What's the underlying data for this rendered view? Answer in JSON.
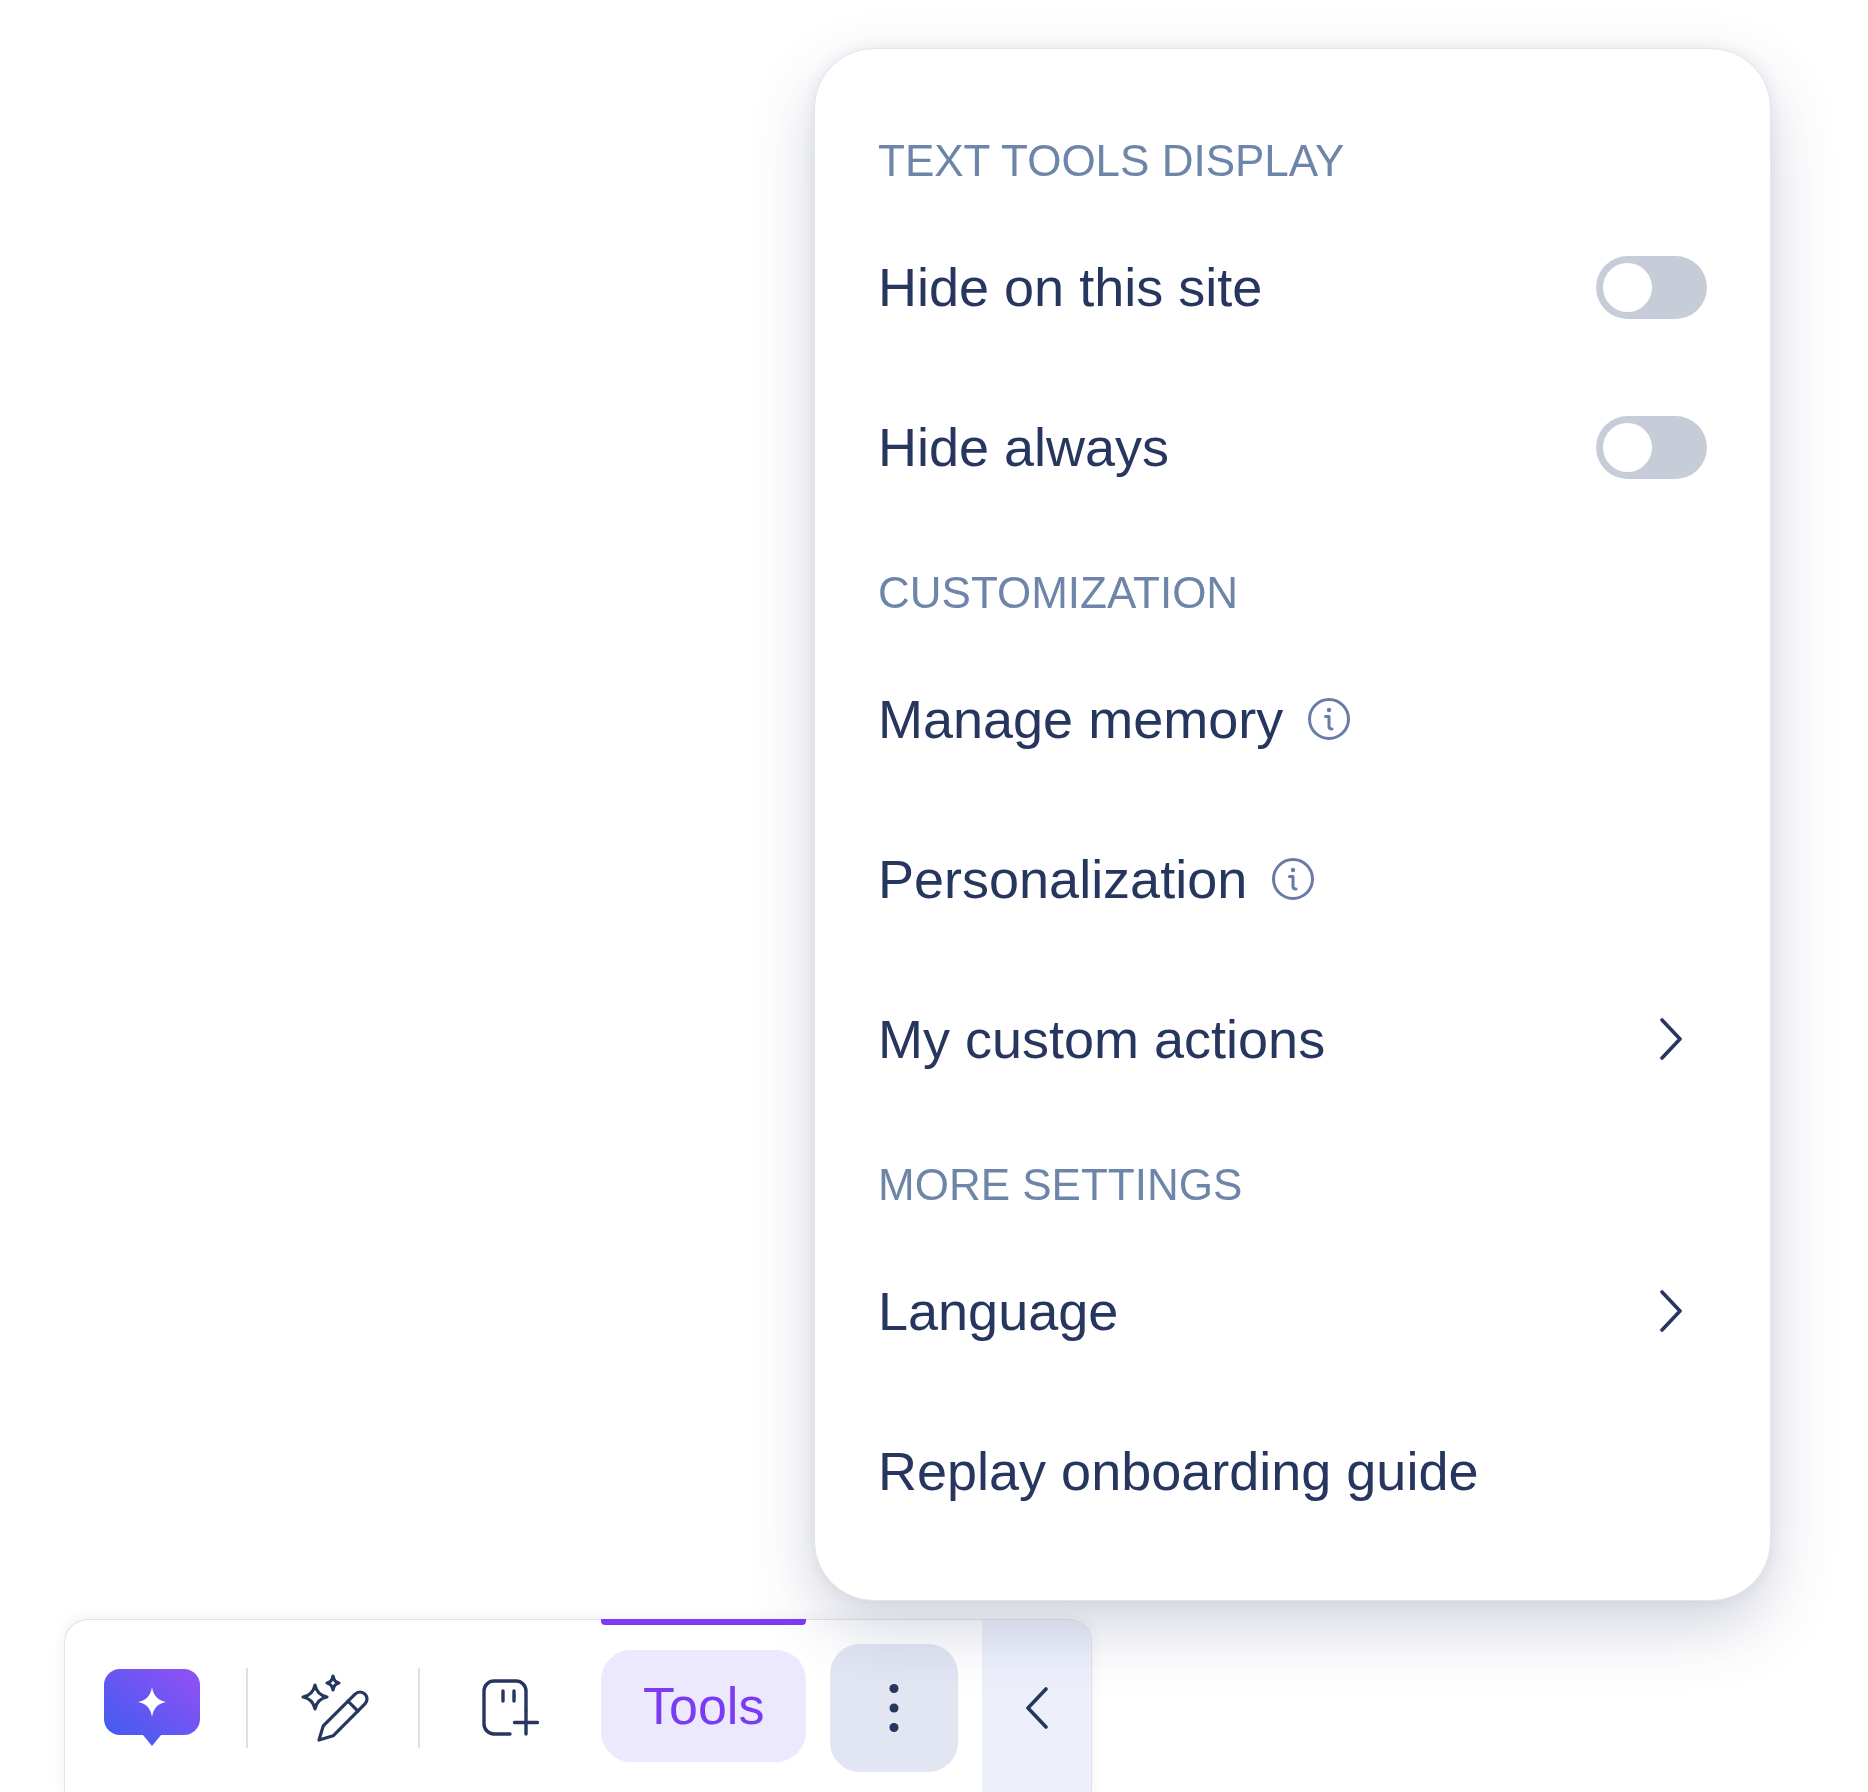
{
  "menu": {
    "sections": [
      {
        "heading": "TEXT TOOLS DISPLAY",
        "items": [
          {
            "kind": "toggle",
            "label": "Hide on this site",
            "on": false
          },
          {
            "kind": "toggle",
            "label": "Hide always",
            "on": false
          }
        ]
      },
      {
        "heading": "CUSTOMIZATION",
        "items": [
          {
            "kind": "info",
            "label": "Manage memory"
          },
          {
            "kind": "info",
            "label": "Personalization"
          },
          {
            "kind": "submenu",
            "label": "My custom actions"
          }
        ]
      },
      {
        "heading": "MORE SETTINGS",
        "items": [
          {
            "kind": "submenu",
            "label": "Language"
          },
          {
            "kind": "plain",
            "label": "Replay onboarding guide"
          }
        ]
      }
    ]
  },
  "toolbar": {
    "items": [
      {
        "kind": "ai-chat"
      },
      {
        "kind": "separator"
      },
      {
        "kind": "magic-pen"
      },
      {
        "kind": "separator"
      },
      {
        "kind": "add-clip"
      },
      {
        "kind": "tab",
        "label": "Tools",
        "selected": true
      },
      {
        "kind": "more",
        "expanded": true
      },
      {
        "kind": "collapse"
      }
    ]
  }
}
